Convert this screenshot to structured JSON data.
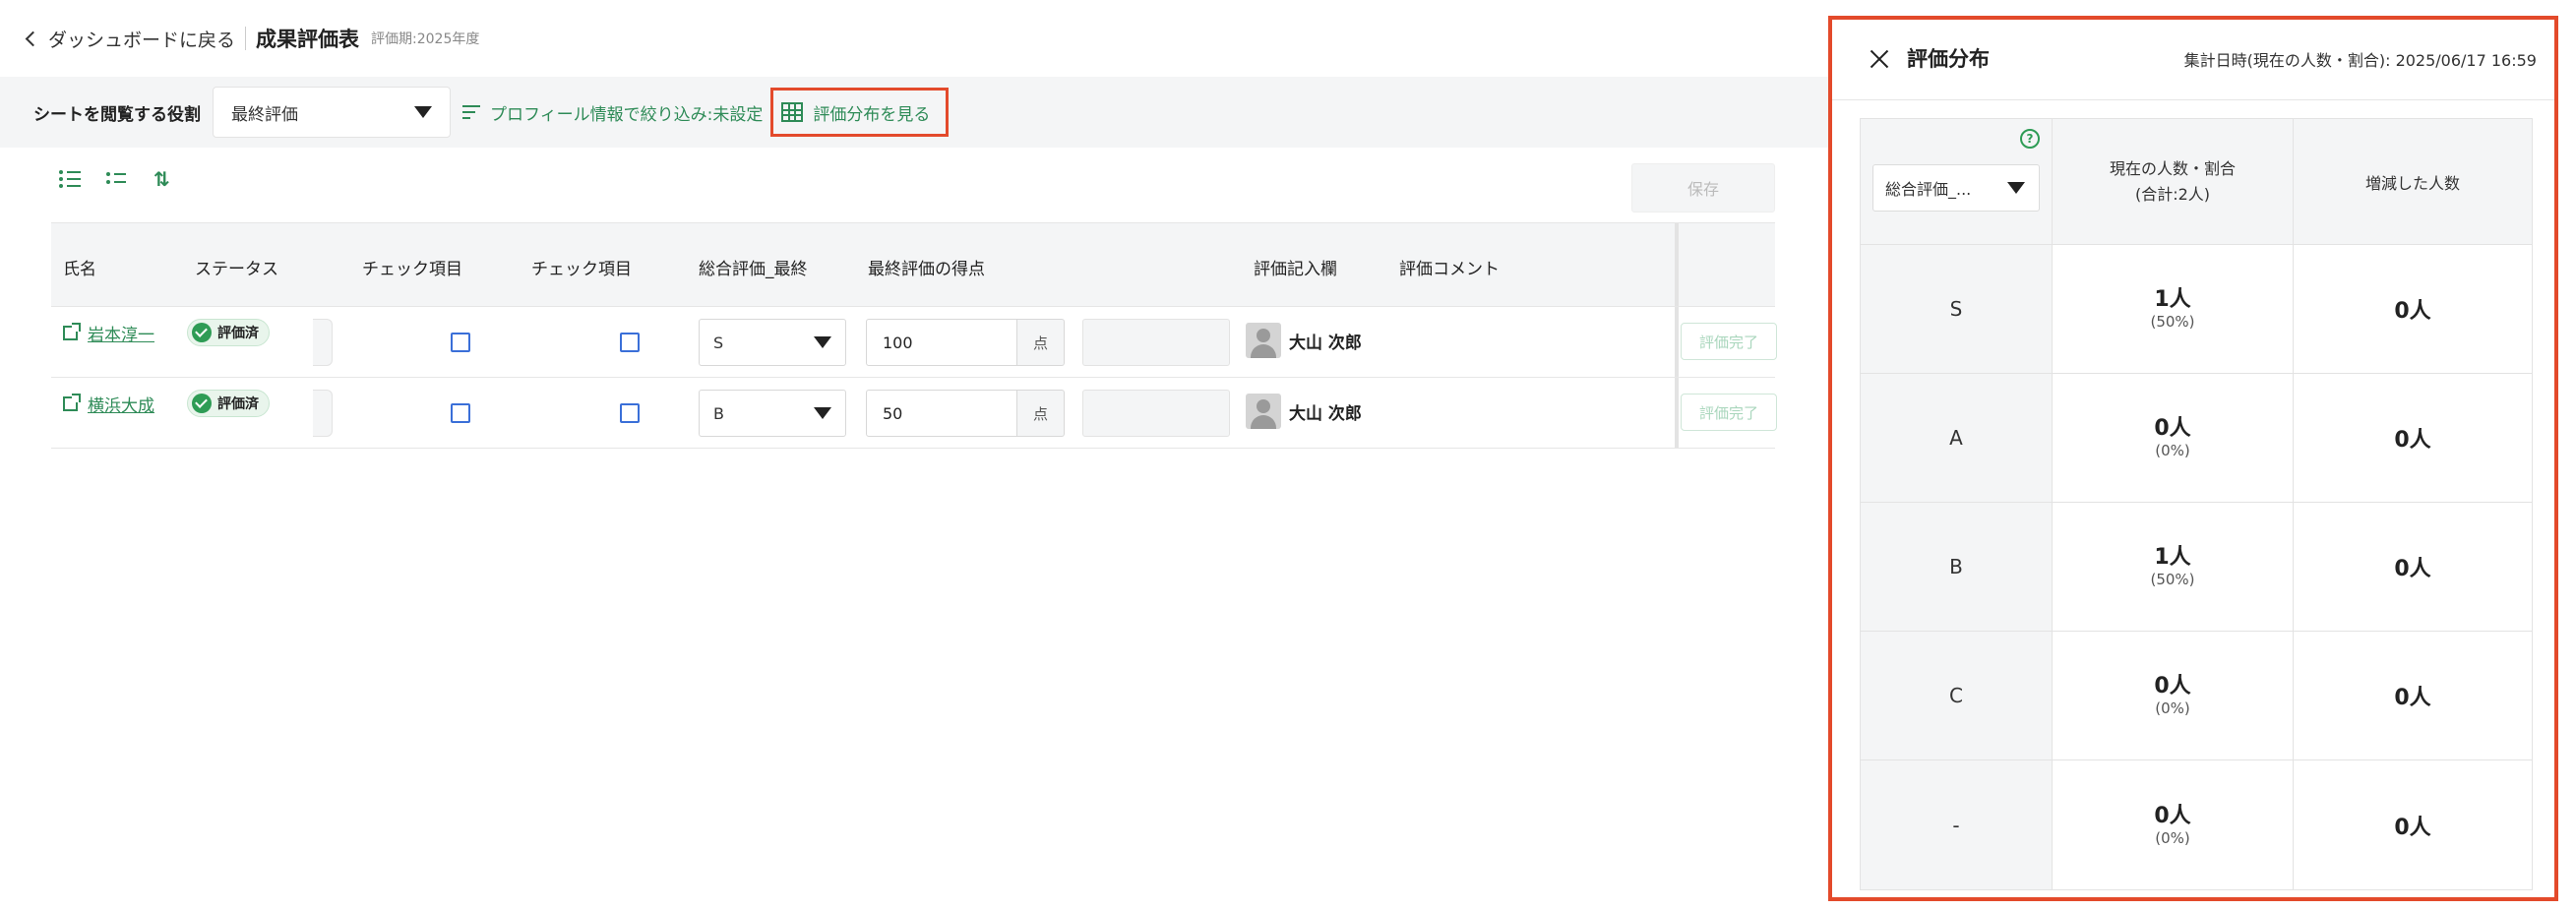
{
  "header": {
    "back_label": "ダッシュボードに戻る",
    "title": "成果評価表",
    "period": "評価期:2025年度"
  },
  "filters": {
    "role_label": "シートを閲覧する役割",
    "role_value": "最終評価",
    "profile_filter": "プロフィール情報で絞り込み:未設定",
    "distribution_link": "評価分布を見る"
  },
  "toolbar": {
    "save_label": "保存"
  },
  "table": {
    "columns": [
      "氏名",
      "ステータス",
      "チェック項目",
      "チェック項目",
      "総合評価_最終",
      "最終評価の得点",
      "評価記入欄",
      "評価コメント"
    ],
    "rows": [
      {
        "name": "岩本淳一",
        "status": "評価済",
        "grade": "S",
        "score": "100",
        "unit": "点",
        "evaluator": "大山 次郎",
        "action": "評価完了"
      },
      {
        "name": "横浜大成",
        "status": "評価済",
        "grade": "B",
        "score": "50",
        "unit": "点",
        "evaluator": "大山 次郎",
        "action": "評価完了"
      }
    ]
  },
  "panel": {
    "title": "評価分布",
    "aggregated": "集計日時(現在の人数・割合): 2025/06/17 16:59",
    "axis_select": "総合評価_...",
    "col_current_line1": "現在の人数・割合",
    "col_current_line2": "(合計:2人)",
    "col_change": "増減した人数",
    "rows": [
      {
        "grade": "S",
        "count": "1人",
        "pct": "(50%)",
        "change": "0人"
      },
      {
        "grade": "A",
        "count": "0人",
        "pct": "(0%)",
        "change": "0人"
      },
      {
        "grade": "B",
        "count": "1人",
        "pct": "(50%)",
        "change": "0人"
      },
      {
        "grade": "C",
        "count": "0人",
        "pct": "(0%)",
        "change": "0人"
      },
      {
        "grade": "-",
        "count": "0人",
        "pct": "(0%)",
        "change": "0人"
      }
    ]
  }
}
